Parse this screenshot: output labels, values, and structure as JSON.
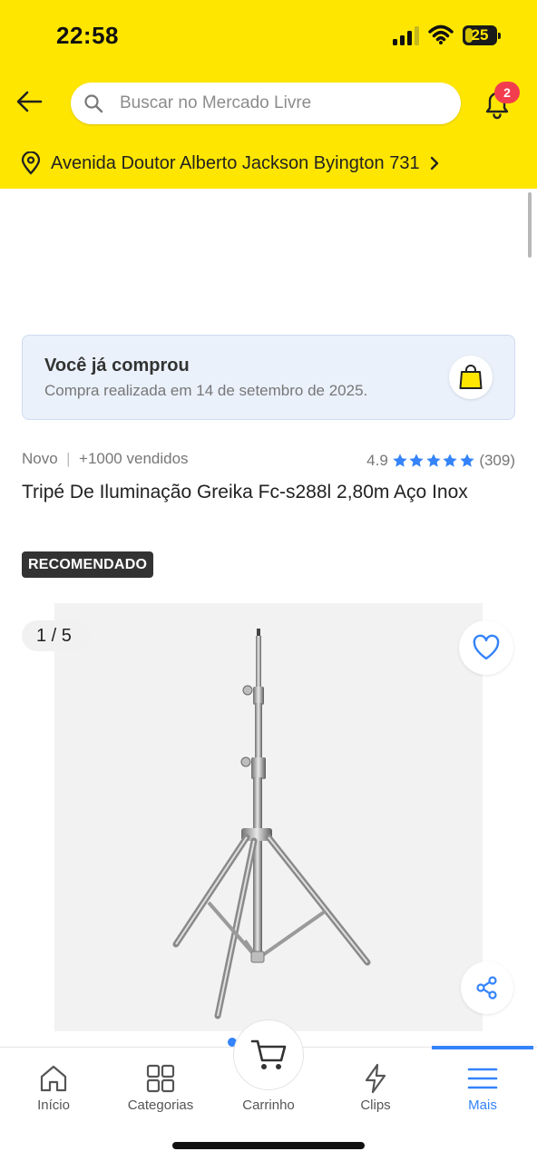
{
  "status_bar": {
    "time": "22:58",
    "battery": "25",
    "battery_level": 0.25
  },
  "header": {
    "search_placeholder": "Buscar no Mercado Livre",
    "notification_count": "2",
    "address": "Avenida Doutor Alberto Jackson Byington 731"
  },
  "purchase_banner": {
    "title": "Você já comprou",
    "subtitle": "Compra realizada em 14 de setembro de 2025."
  },
  "product": {
    "condition": "Novo",
    "sold": "+1000 vendidos",
    "separator": "|",
    "rating": "4.9",
    "rating_stars": 5,
    "reviews": "(309)",
    "title": "Tripé De Iluminação Greika Fc-s288l 2,80m Aço Inox",
    "badge": "RECOMENDADO",
    "gallery_counter": "1 / 5"
  },
  "bottom_nav": {
    "items": [
      {
        "label": "Início",
        "icon": "home-icon"
      },
      {
        "label": "Categorias",
        "icon": "grid-icon"
      },
      {
        "label": "Carrinho",
        "icon": "cart-icon"
      },
      {
        "label": "Clips",
        "icon": "lightning-icon"
      },
      {
        "label": "Mais",
        "icon": "menu-icon"
      }
    ],
    "active": "Mais"
  },
  "colors": {
    "brand_yellow": "#FFE600",
    "accent_blue": "#3483FA",
    "badge_red": "#F23D4F",
    "banner_bg": "#EAF1FB"
  }
}
